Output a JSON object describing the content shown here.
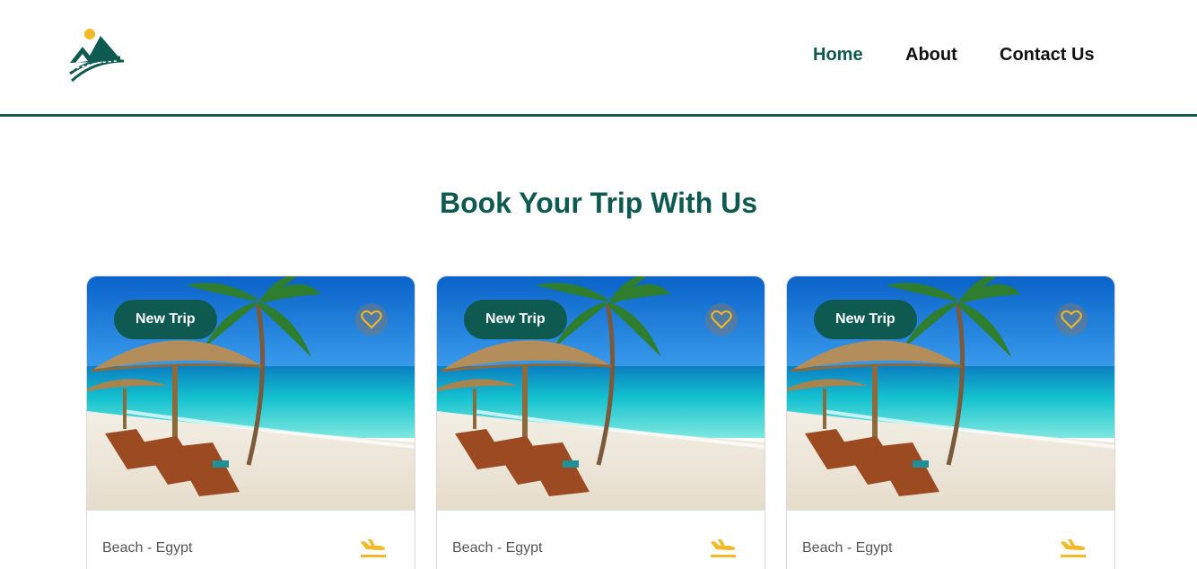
{
  "nav": {
    "home": "Home",
    "about": "About",
    "contact": "Contact Us"
  },
  "colors": {
    "brand": "#0f5a50",
    "accent": "#f2b928"
  },
  "hero": {
    "title": "Book Your Trip With Us"
  },
  "cards": [
    {
      "badge": "New Trip",
      "location": "Beach - Egypt",
      "image": "beach-palapa-photo",
      "icons": [
        "heart-icon",
        "plane-landing-icon"
      ]
    },
    {
      "badge": "New Trip",
      "location": "Beach - Egypt",
      "image": "beach-palapa-photo",
      "icons": [
        "heart-icon",
        "plane-landing-icon"
      ]
    },
    {
      "badge": "New Trip",
      "location": "Beach - Egypt",
      "image": "beach-palapa-photo",
      "icons": [
        "heart-icon",
        "plane-landing-icon"
      ]
    }
  ]
}
